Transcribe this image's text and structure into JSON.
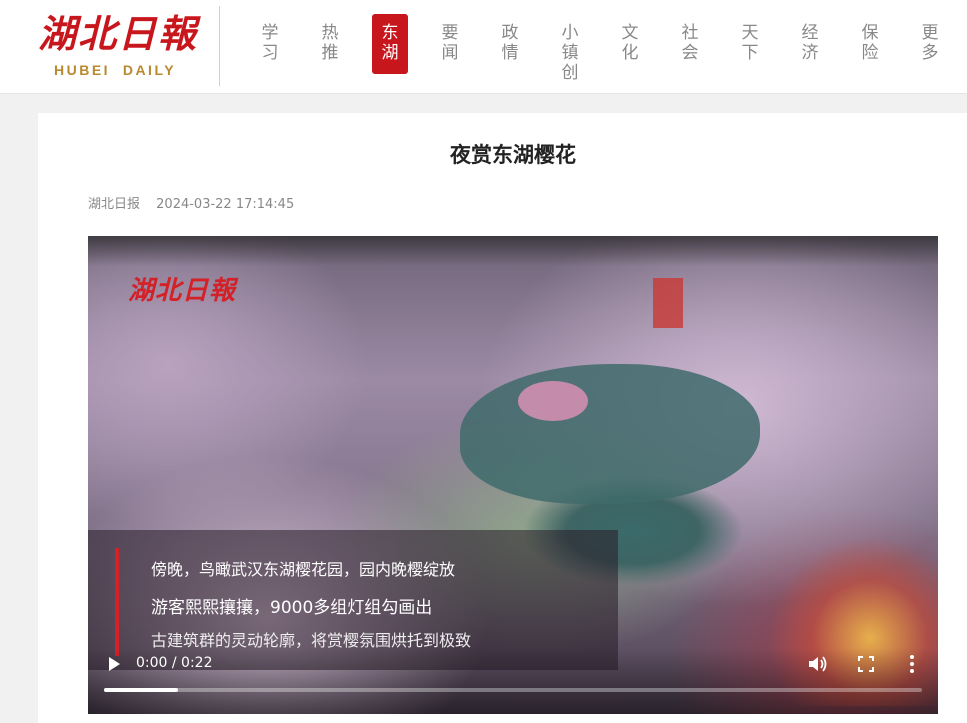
{
  "header": {
    "logo_cn": "湖北日報",
    "logo_en": "HUBEI  DAILY",
    "nav": [
      {
        "label": "学习",
        "active": false
      },
      {
        "label": "热推",
        "active": false
      },
      {
        "label": "东湖",
        "active": true
      },
      {
        "label": "要闻",
        "active": false
      },
      {
        "label": "政情",
        "active": false
      },
      {
        "label": "小镇创",
        "active": false
      },
      {
        "label": "文化",
        "active": false
      },
      {
        "label": "社会",
        "active": false
      },
      {
        "label": "天下",
        "active": false
      },
      {
        "label": "经济",
        "active": false
      },
      {
        "label": "保险",
        "active": false
      },
      {
        "label": "更多",
        "active": false
      }
    ]
  },
  "article": {
    "title": "夜赏东湖樱花",
    "source": "湖北日报",
    "datetime": "2024-03-22 17:14:45"
  },
  "video": {
    "watermark": "湖北日報",
    "subtitles": [
      "傍晚，鸟瞰武汉东湖樱花园，园内晚樱绽放",
      "游客熙熙攘攘，9000多组灯组勾画出",
      "古建筑群的灵动轮廓，将赏樱氛围烘托到极致"
    ],
    "time_display": "0:00 / 0:22",
    "progress_fraction": 0.09,
    "icons": [
      "play-icon",
      "volume-icon",
      "fullscreen-icon",
      "more-options-icon"
    ]
  },
  "colors": {
    "brand_red": "#c8161d",
    "brand_gold": "#b8892e",
    "nav_text": "#888888"
  }
}
